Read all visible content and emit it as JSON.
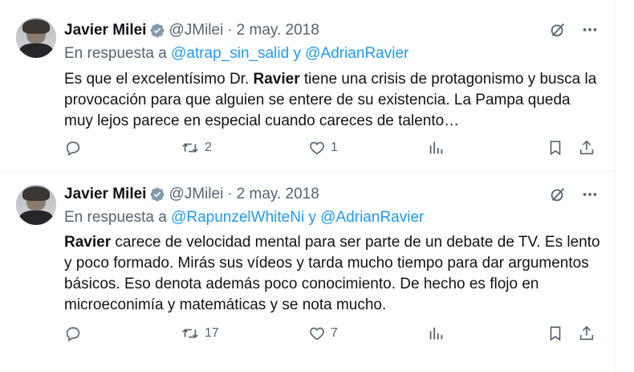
{
  "tweets": [
    {
      "author_name": "Javier Milei",
      "handle": "@JMilei",
      "date": "2 may. 2018",
      "reply_prefix": "En respuesta a",
      "reply_to_1": "@atrap_sin_salid",
      "reply_joiner": "y",
      "reply_to_2": "@AdrianRavier",
      "text_before": "Es que el excelentísimo Dr. ",
      "text_bold": "Ravier",
      "text_after": " tiene una crisis de protagonismo y busca la provocación para que alguien se entere de su existencia. La Pampa queda muy lejos parece en especial cuando careces de talento…",
      "retweets": "2",
      "likes": "1",
      "replies": "",
      "views": ""
    },
    {
      "author_name": "Javier Milei",
      "handle": "@JMilei",
      "date": "2 may. 2018",
      "reply_prefix": "En respuesta a",
      "reply_to_1": "@RapunzelWhiteNi",
      "reply_joiner": "y",
      "reply_to_2": "@AdrianRavier",
      "text_before": "",
      "text_bold": "Ravier",
      "text_after": " carece de velocidad mental para ser parte de un debate de TV. Es lento y poco formado. Mirás sus vídeos y tarda mucho tiempo para dar argumentos básicos. Eso denota además poco conocimiento. De hecho es flojo en microeconimía y matemáticas y se nota mucho.",
      "retweets": "17",
      "likes": "7",
      "replies": "",
      "views": ""
    }
  ],
  "separator": "·",
  "colors": {
    "text": "#0f1419",
    "muted": "#536471",
    "link": "#1d9bf0",
    "verified": "#829aab",
    "border": "#eff3f4"
  },
  "icons": [
    "verified-badge-icon",
    "grok-icon",
    "more-icon",
    "reply-icon",
    "retweet-icon",
    "like-icon",
    "views-icon",
    "bookmark-icon",
    "share-icon"
  ]
}
